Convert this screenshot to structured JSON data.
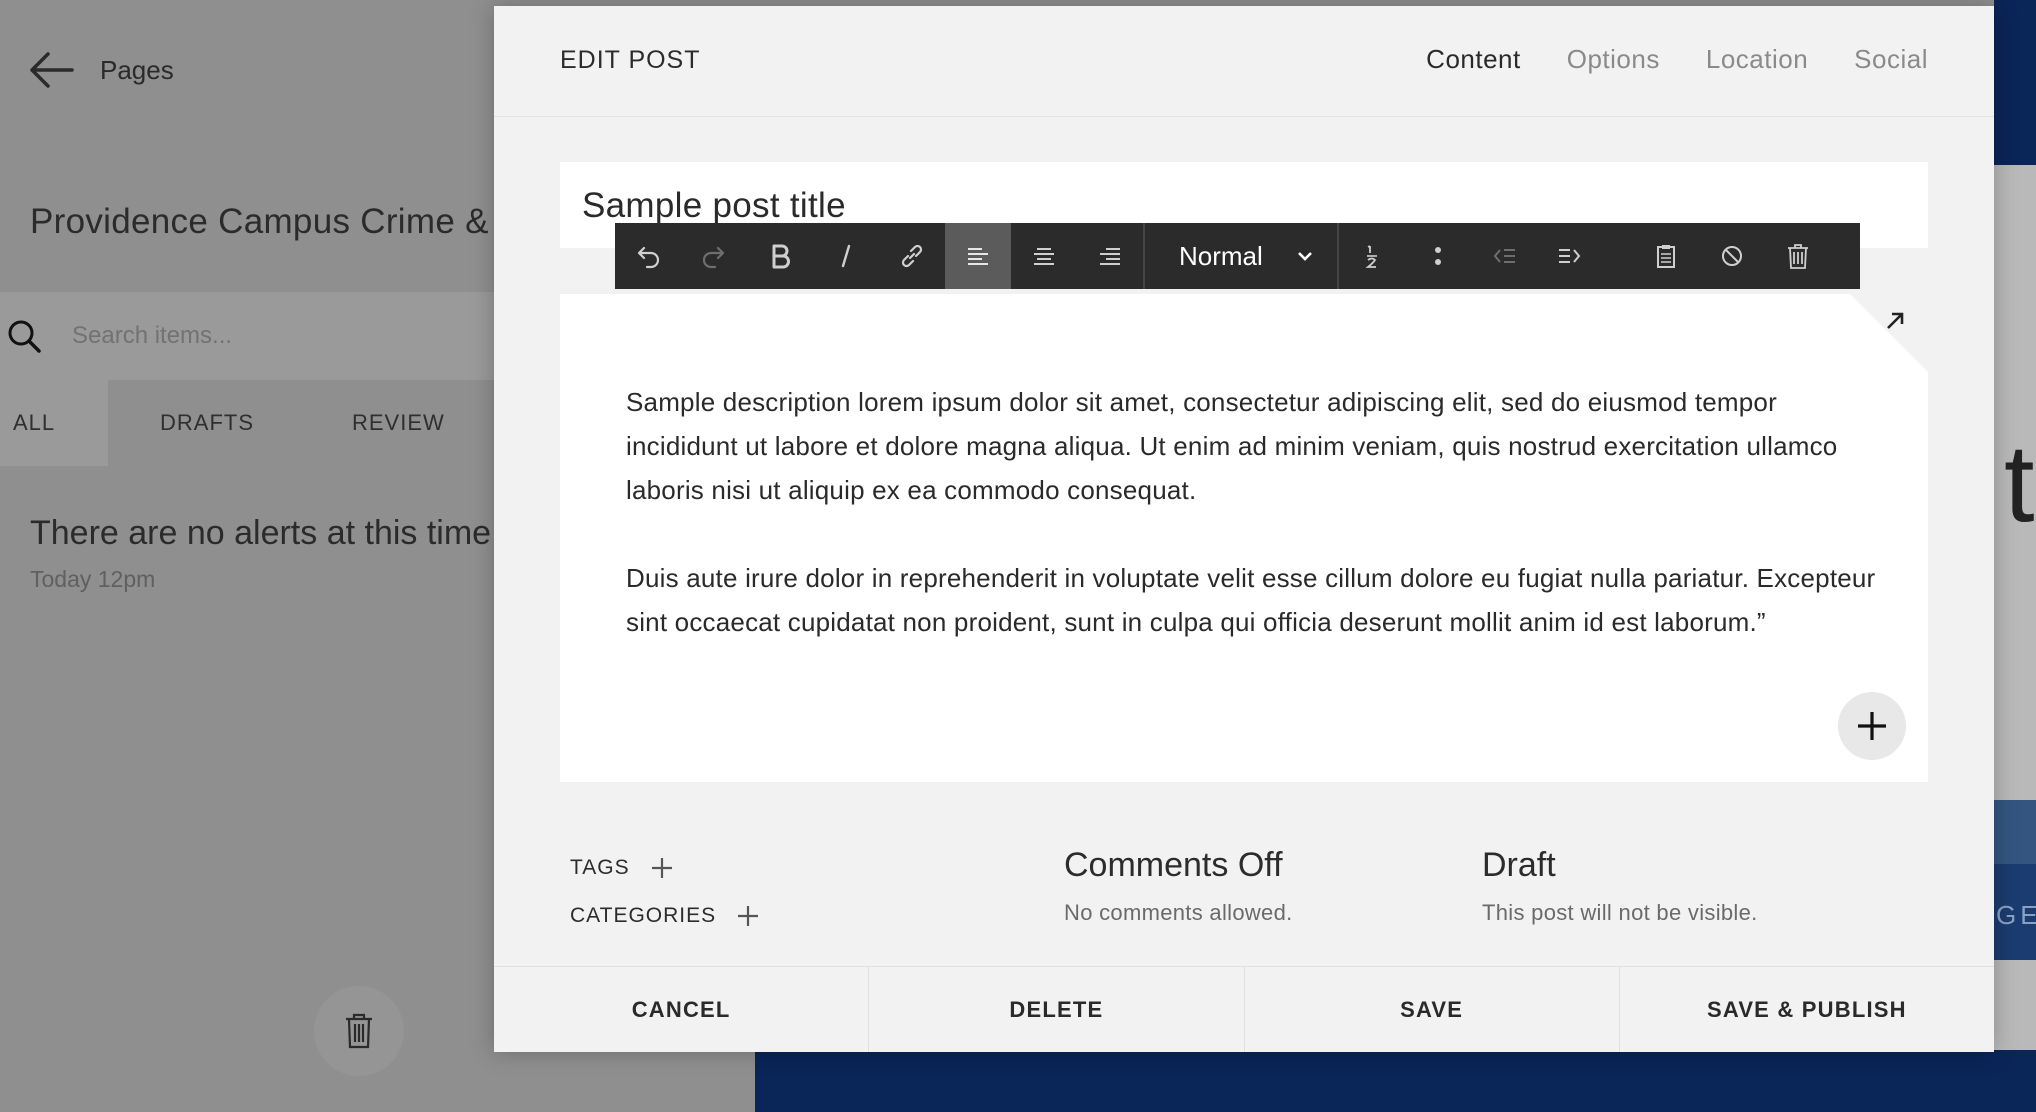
{
  "background": {
    "back_label": "Pages",
    "site_title": "Providence Campus Crime & Safety",
    "search_placeholder": "Search items...",
    "tabs": [
      "ALL",
      "DRAFTS",
      "REVIEW"
    ],
    "alert_text": "There are no alerts at this time",
    "alert_time": "Today 12pm",
    "right_edge_letter": "t",
    "right_edge_button_text": "GET"
  },
  "modal": {
    "title": "EDIT POST",
    "tabs": [
      {
        "label": "Content",
        "active": true
      },
      {
        "label": "Options",
        "active": false
      },
      {
        "label": "Location",
        "active": false
      },
      {
        "label": "Social",
        "active": false
      }
    ],
    "post_title": "Sample post title",
    "toolbar": {
      "format_label": "Normal",
      "icons": [
        "undo-icon",
        "redo-icon",
        "bold-icon",
        "italic-icon",
        "link-icon",
        "align-left-icon",
        "align-center-icon",
        "align-right-icon",
        "numbered-list-icon",
        "bullet-list-icon",
        "outdent-icon",
        "indent-icon",
        "paste-icon",
        "clear-format-icon",
        "delete-block-icon"
      ],
      "active": "align-left-icon"
    },
    "body": {
      "paragraph1": "Sample description lorem ipsum dolor sit amet, consectetur adipiscing elit, sed do eiusmod tempor incididunt ut labore et dolore magna aliqua. Ut enim ad minim veniam, quis nostrud exercitation ullamco laboris nisi ut aliquip ex ea commodo consequat.",
      "paragraph2": "Duis aute irure dolor in reprehenderit in voluptate velit esse cillum dolore eu fugiat nulla pariatur. Excepteur sint occaecat cupidatat non proident, sunt in culpa qui officia deserunt mollit anim id est laborum.”"
    },
    "meta": {
      "tags_label": "TAGS",
      "categories_label": "CATEGORIES",
      "comments_title": "Comments Off",
      "comments_sub": "No comments allowed.",
      "status_title": "Draft",
      "status_sub": "This post will not be visible."
    },
    "footer": {
      "cancel": "CANCEL",
      "delete": "DELETE",
      "save": "SAVE",
      "save_publish": "SAVE & PUBLISH"
    }
  },
  "colors": {
    "toolbar_bg": "#2b2b2b",
    "toolbar_active": "#5b5b5b",
    "modal_bg": "#f2f2f2",
    "overlay": "#8f8f8f",
    "navy": "#0a2557"
  }
}
